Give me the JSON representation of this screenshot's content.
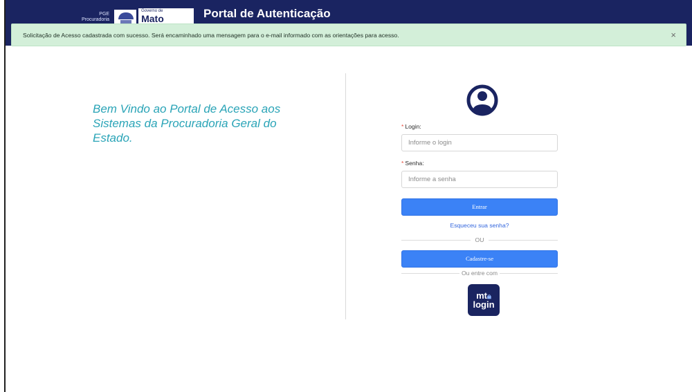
{
  "header": {
    "logo_pge_line1": "PGE",
    "logo_pge_line2": "Procuradoria",
    "logo_gov_small": "Governo de",
    "logo_gov_big": "Mato",
    "title": "Portal de Autenticação"
  },
  "alert": {
    "message": "Solicitação de Acesso cadastrada com sucesso. Será encaminhado uma mensagem para o e-mail informado com as orientações para acesso.",
    "close_label": "×"
  },
  "welcome": {
    "text": "Bem Vindo ao Portal de Acesso aos Sistemas da Procuradoria Geral do Estado."
  },
  "login_form": {
    "login_required_mark": "*",
    "login_label": "Login:",
    "login_placeholder": "Informe o login",
    "login_value": "",
    "password_required_mark": "*",
    "password_label": "Senha:",
    "password_placeholder": "Informe a senha",
    "password_value": "",
    "submit_label": "Entrar",
    "forgot_password_label": "Esqueceu sua senha?",
    "or_separator": "OU",
    "register_label": "Cadastre-se",
    "or_enter_with": "Ou entre com",
    "mtlogin_line1": "mt",
    "mtlogin_line2": "login"
  },
  "icons": {
    "user": "user-circle-icon",
    "close": "close-icon",
    "mtlogin_lock": "lock-icon"
  },
  "colors": {
    "header_bg": "#1a2461",
    "alert_bg": "#d3efd9",
    "welcome_text": "#2aa4b7",
    "primary_button": "#3b82f6",
    "link": "#3366dd",
    "mtlogin_bg": "#1a2460"
  }
}
